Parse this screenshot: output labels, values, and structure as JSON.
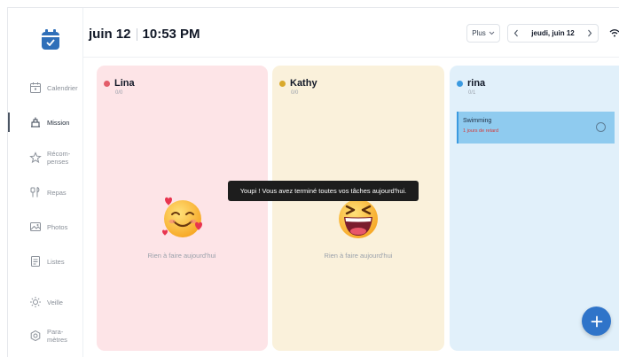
{
  "header": {
    "date": "juin 12",
    "time": "10:53 PM"
  },
  "toolbar": {
    "more_label": "Plus",
    "date_label": "jeudi, juin 12"
  },
  "sidebar": {
    "items": [
      {
        "label": "Calendrier",
        "icon": "calendar-icon"
      },
      {
        "label": "Mission",
        "icon": "mission-icon",
        "active": true
      },
      {
        "label": "Récom-\npenses",
        "icon": "star-icon"
      },
      {
        "label": "Repas",
        "icon": "utensils-icon"
      },
      {
        "label": "Photos",
        "icon": "photo-icon"
      },
      {
        "label": "Listes",
        "icon": "list-icon"
      },
      {
        "label": "Veille",
        "icon": "sun-icon"
      },
      {
        "label": "Para-\nmètres",
        "icon": "settings-icon"
      }
    ]
  },
  "members": [
    {
      "name": "Lina",
      "count": "0/0",
      "color": "#e35d6a",
      "empty_text": "Rien à faire aujourd'hui",
      "emoji": "smiling-face-with-hearts"
    },
    {
      "name": "Kathy",
      "count": "0/0",
      "color": "#d9a92a",
      "empty_text": "Rien à faire aujourd'hui",
      "emoji": "grinning-squinting-face"
    },
    {
      "name": "rina",
      "count": "0/1",
      "color": "#3b9ae0",
      "tasks": [
        {
          "title": "Swimming",
          "status": "1 jours de retard"
        }
      ]
    }
  ],
  "tooltip": "Youpi ! Vous avez terminé toutes vos tâches aujourd'hui.",
  "colors": {
    "accent": "#2f74c9",
    "lina_bg": "#fde4e7",
    "kathy_bg": "#faf1db",
    "rina_bg": "#e1f0fa"
  }
}
